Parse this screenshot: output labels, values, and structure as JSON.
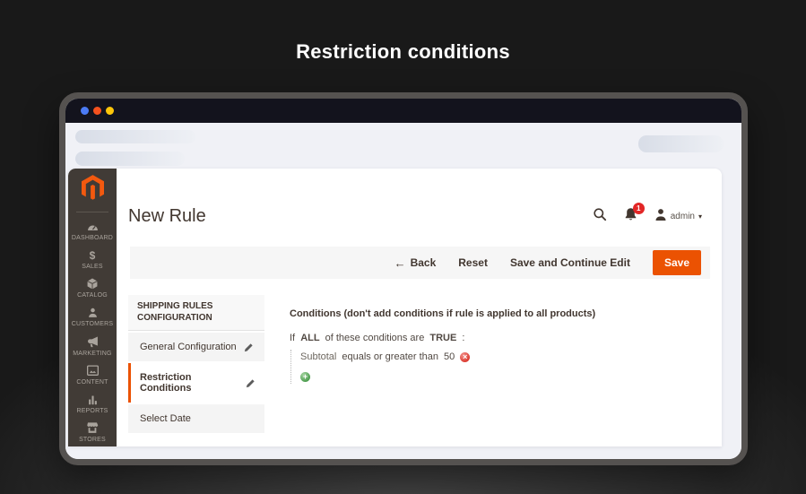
{
  "page": {
    "title": "Restriction conditions"
  },
  "browser": {
    "traffic_lights": [
      {
        "name": "blue",
        "color": "#4b7bf5"
      },
      {
        "name": "orange",
        "color": "#f4511e"
      },
      {
        "name": "yellow",
        "color": "#fdc60a"
      }
    ]
  },
  "admin": {
    "sidebar": {
      "items": [
        {
          "label": "DASHBOARD",
          "icon": "dashboard-icon"
        },
        {
          "label": "SALES",
          "icon": "sales-icon"
        },
        {
          "label": "CATALOG",
          "icon": "catalog-icon"
        },
        {
          "label": "CUSTOMERS",
          "icon": "customers-icon"
        },
        {
          "label": "MARKETING",
          "icon": "marketing-icon"
        },
        {
          "label": "CONTENT",
          "icon": "content-icon"
        },
        {
          "label": "REPORTS",
          "icon": "reports-icon"
        },
        {
          "label": "STORES",
          "icon": "stores-icon"
        }
      ]
    },
    "header": {
      "title": "New Rule",
      "notification_count": "1",
      "user_label": "admin"
    },
    "toolbar": {
      "back_label": "Back",
      "reset_label": "Reset",
      "save_continue_label": "Save and Continue Edit",
      "save_label": "Save"
    },
    "config_nav": {
      "header": "SHIPPING RULES CONFIGURATION",
      "items": [
        {
          "label": "General Configuration"
        },
        {
          "label": "Restriction Conditions"
        },
        {
          "label": "Select Date"
        }
      ]
    },
    "conditions": {
      "heading": "Conditions (don't add conditions if rule is applied to all products)",
      "sentence": {
        "prefix": "If",
        "aggregator": "ALL",
        "middle": "of these conditions are",
        "value": "TRUE",
        "suffix": ":"
      },
      "rows": [
        {
          "attribute": "Subtotal",
          "operator": "equals or greater than",
          "value": "50"
        }
      ]
    }
  },
  "colors": {
    "accent_orange": "#eb5202",
    "magento_logo": "#f3590f",
    "badge_red": "#e22626",
    "remove_red": "#dc3c32",
    "add_green": "#4f9e51"
  }
}
